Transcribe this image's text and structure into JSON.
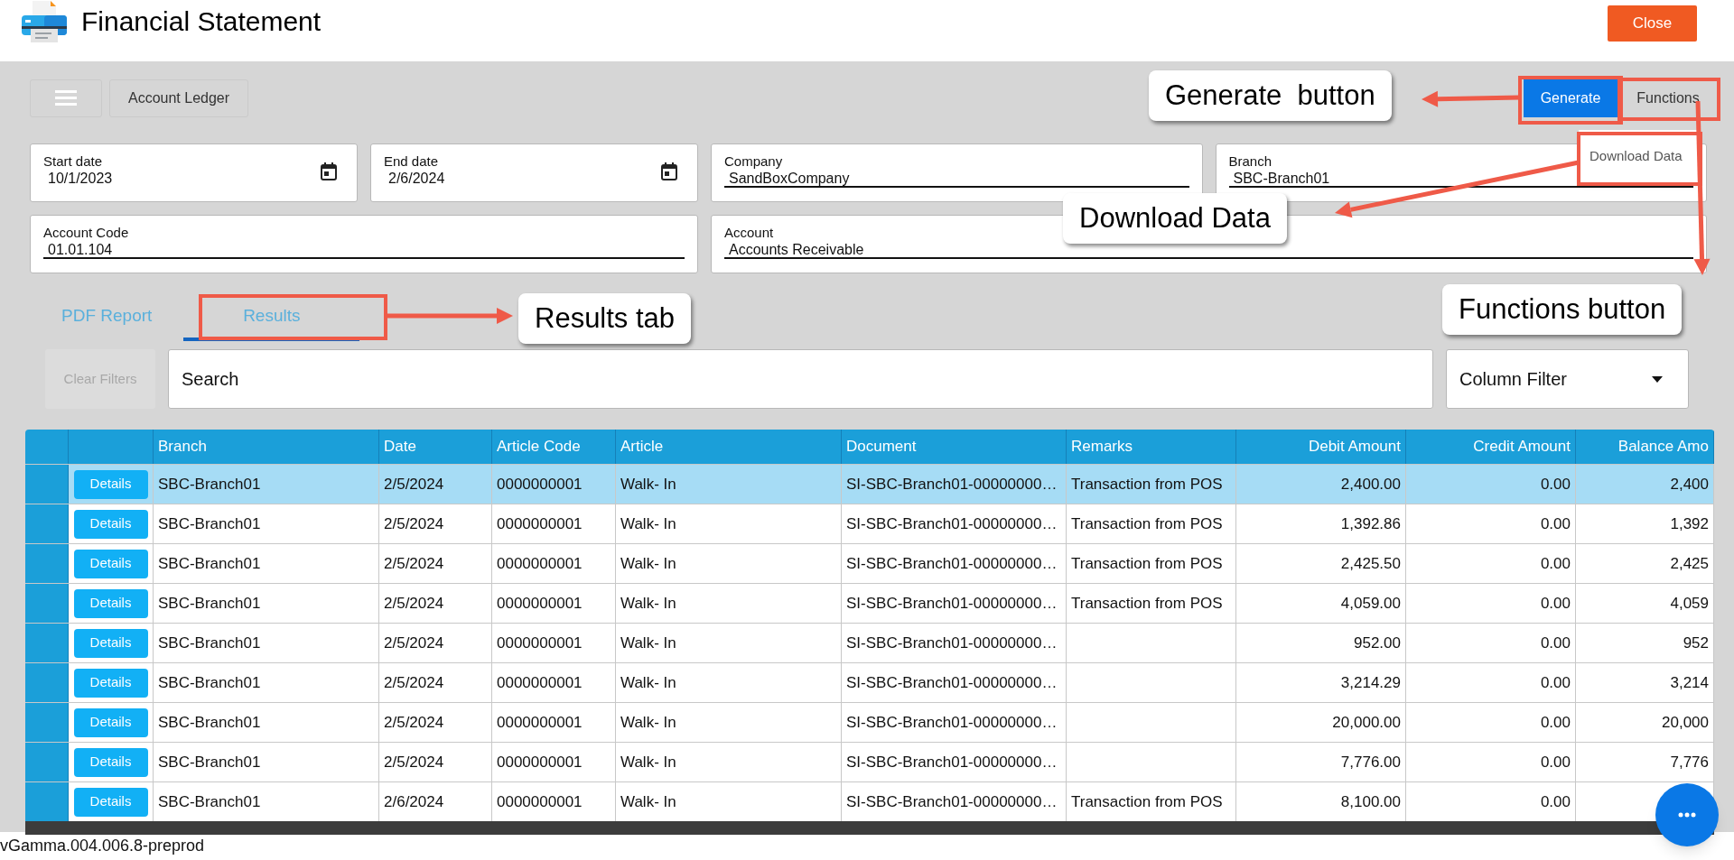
{
  "window": {
    "title": "Financial Statement",
    "close_label": "Close"
  },
  "toolbar": {
    "breadcrumb": "Account Ledger",
    "generate_label": "Generate",
    "functions_label": "Functions"
  },
  "functions_menu": {
    "open": true,
    "items": [
      "Download Data"
    ]
  },
  "fields": [
    {
      "kind": "date",
      "label": "Start date",
      "value": "10/1/2023"
    },
    {
      "kind": "date",
      "label": "End date",
      "value": "2/6/2024"
    },
    {
      "kind": "lookup",
      "label": "Company",
      "value": "SandBoxCompany"
    },
    {
      "kind": "lookup",
      "label": "Branch",
      "value": "SBC-Branch01"
    },
    {
      "kind": "lookup",
      "label": "Account Code",
      "value": "01.01.104"
    },
    {
      "kind": "lookup",
      "label": "Account",
      "value": "Accounts Receivable"
    }
  ],
  "tabs": [
    {
      "label": "PDF Report",
      "selected": false
    },
    {
      "label": "Results",
      "selected": true
    }
  ],
  "filters": {
    "clear_label": "Clear Filters",
    "clear_disabled": true,
    "search_placeholder": "Search",
    "column_filter": "Column Filter"
  },
  "table": {
    "columns": [
      "Branch",
      "Date",
      "Article Code",
      "Article",
      "Document",
      "Remarks",
      "Debit Amount",
      "Credit Amount",
      "Balance Amo"
    ],
    "rows": [
      {
        "selected": true,
        "action": "Details",
        "cells": [
          "SBC-Branch01",
          "2/5/2024",
          "0000000001",
          "Walk- In",
          "SI-SBC-Branch01-00000000…",
          "Transaction from POS",
          "2,400.00",
          "0.00",
          "2,400"
        ]
      },
      {
        "selected": false,
        "action": "Details",
        "cells": [
          "SBC-Branch01",
          "2/5/2024",
          "0000000001",
          "Walk- In",
          "SI-SBC-Branch01-00000000…",
          "Transaction from POS",
          "1,392.86",
          "0.00",
          "1,392"
        ]
      },
      {
        "selected": false,
        "action": "Details",
        "cells": [
          "SBC-Branch01",
          "2/5/2024",
          "0000000001",
          "Walk- In",
          "SI-SBC-Branch01-00000000…",
          "Transaction from POS",
          "2,425.50",
          "0.00",
          "2,425"
        ]
      },
      {
        "selected": false,
        "action": "Details",
        "cells": [
          "SBC-Branch01",
          "2/5/2024",
          "0000000001",
          "Walk- In",
          "SI-SBC-Branch01-00000000…",
          "Transaction from POS",
          "4,059.00",
          "0.00",
          "4,059"
        ]
      },
      {
        "selected": false,
        "action": "Details",
        "cells": [
          "SBC-Branch01",
          "2/5/2024",
          "0000000001",
          "Walk- In",
          "SI-SBC-Branch01-00000000…",
          null,
          "952.00",
          "0.00",
          "952"
        ]
      },
      {
        "selected": false,
        "action": "Details",
        "cells": [
          "SBC-Branch01",
          "2/5/2024",
          "0000000001",
          "Walk- In",
          "SI-SBC-Branch01-00000000…",
          null,
          "3,214.29",
          "0.00",
          "3,214"
        ]
      },
      {
        "selected": false,
        "action": "Details",
        "cells": [
          "SBC-Branch01",
          "2/5/2024",
          "0000000001",
          "Walk- In",
          "SI-SBC-Branch01-00000000…",
          null,
          "20,000.00",
          "0.00",
          "20,000"
        ]
      },
      {
        "selected": false,
        "action": "Details",
        "cells": [
          "SBC-Branch01",
          "2/5/2024",
          "0000000001",
          "Walk- In",
          "SI-SBC-Branch01-00000000…",
          null,
          "7,776.00",
          "0.00",
          "7,776"
        ]
      },
      {
        "selected": false,
        "action": "Details",
        "cells": [
          "SBC-Branch01",
          "2/6/2024",
          "0000000001",
          "Walk- In",
          "SI-SBC-Branch01-00000000…",
          "Transaction from POS",
          "8,100.00",
          "0.00",
          null
        ]
      }
    ]
  },
  "version": "vGamma.004.006.8-preprod",
  "annotations": [
    {
      "text": "Generate  button"
    },
    {
      "text": "Download Data"
    },
    {
      "text": "Results tab"
    },
    {
      "text": "Functions button"
    }
  ]
}
